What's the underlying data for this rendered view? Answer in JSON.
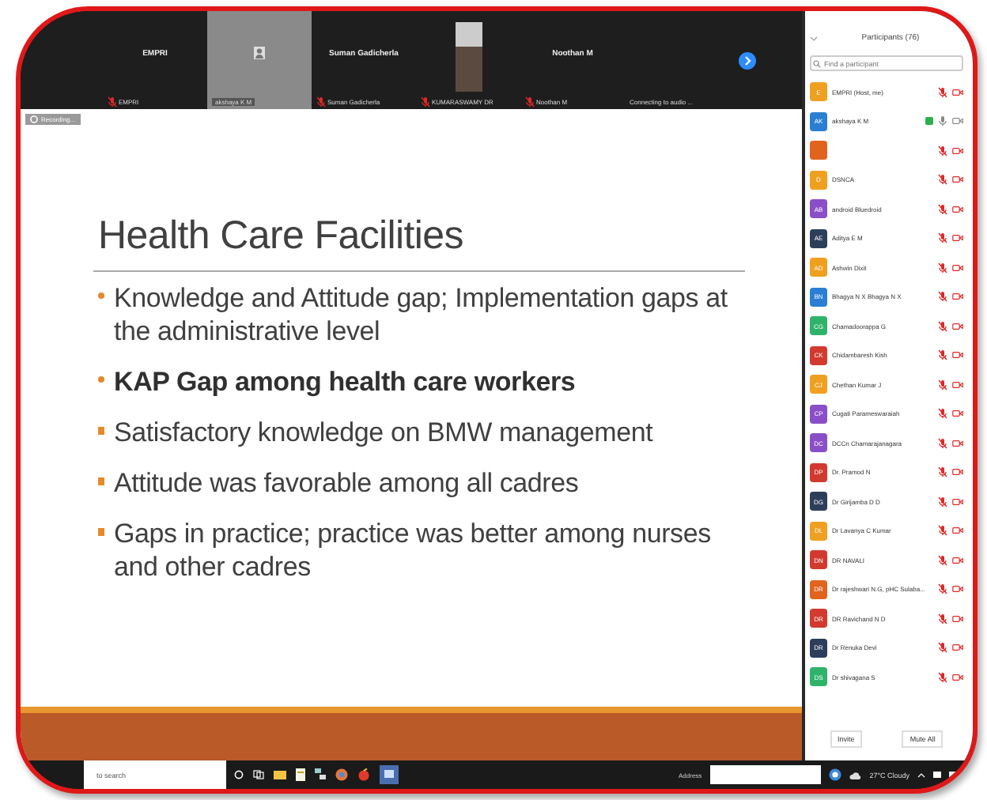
{
  "video_strip": {
    "tiles": [
      {
        "kind": "name",
        "name": "EMPRI",
        "label": "EMPRI",
        "muted": true
      },
      {
        "kind": "icon",
        "label": "akshaya K M",
        "muted": false
      },
      {
        "kind": "name",
        "name": "Suman Gadicherla",
        "label": "Suman Gadicherla",
        "muted": true
      },
      {
        "kind": "photo",
        "label": "KUMARASWAMY DR",
        "muted": true
      },
      {
        "kind": "name",
        "name": "Noothan M",
        "label": "Noothan M",
        "muted": true
      },
      {
        "kind": "blank",
        "label": "Connecting to audio ...",
        "muted": false
      }
    ]
  },
  "recording": {
    "label": "Recording..."
  },
  "slide": {
    "title": "Health Care Facilities",
    "bullets": [
      {
        "kind": "dot",
        "text": "Knowledge and Attitude gap; Implementation gaps at the administrative level",
        "bold": false
      },
      {
        "kind": "dot",
        "text": "KAP Gap among health care workers",
        "bold": true
      },
      {
        "kind": "square",
        "text": "Satisfactory knowledge on BMW management",
        "bold": false
      },
      {
        "kind": "square",
        "text": "Attitude was favorable among all cadres",
        "bold": false
      },
      {
        "kind": "square",
        "text": "Gaps in practice; practice was better among nurses and other cadres",
        "bold": false
      }
    ]
  },
  "participants": {
    "title": "Participants (76)",
    "search": {
      "placeholder": "Find a participant"
    },
    "items": [
      {
        "initials": "E",
        "name": "EMPRI (Host, me)",
        "color": "#f0a020",
        "muted": true,
        "speaking": false
      },
      {
        "initials": "AK",
        "name": "akshaya K M",
        "color": "#2a7fd4",
        "muted": false,
        "speaking": true
      },
      {
        "color": "#e0641e",
        "muted": true,
        "speaking": false
      },
      {
        "initials": "D",
        "name": "DSNCA",
        "color": "#f0a020",
        "muted": true,
        "speaking": false
      },
      {
        "initials": "AB",
        "name": "android Bluedroid",
        "color": "#8a4fc8",
        "muted": true,
        "speaking": false
      },
      {
        "initials": "AE",
        "name": "Aditya E M",
        "color": "#2c3e5a",
        "muted": true,
        "speaking": false
      },
      {
        "initials": "AD",
        "name": "Ashwin Dixit",
        "color": "#f0a020",
        "muted": true,
        "speaking": false
      },
      {
        "initials": "BN",
        "name": "Bhagya N X Bhagya N X",
        "color": "#2a7fd4",
        "muted": true,
        "speaking": false
      },
      {
        "initials": "CG",
        "name": "Chamadoorappa G",
        "color": "#2fb36a",
        "muted": true,
        "speaking": false
      },
      {
        "initials": "CK",
        "name": "Chidambaresh Kish",
        "color": "#d23a30",
        "muted": true,
        "speaking": false
      },
      {
        "initials": "CJ",
        "name": "Chethan Kumar J",
        "color": "#f0a020",
        "muted": true,
        "speaking": false
      },
      {
        "initials": "CP",
        "name": "Cugati Parameswaraiah",
        "color": "#8a4fc8",
        "muted": true,
        "speaking": false
      },
      {
        "initials": "DC",
        "name": "DCCn Chamarajanagara",
        "color": "#8a4fc8",
        "muted": true,
        "speaking": false
      },
      {
        "initials": "DP",
        "name": "Dr. Pramod N",
        "color": "#d23a30",
        "muted": true,
        "speaking": false
      },
      {
        "initials": "DG",
        "name": "Dr Girijamba D D",
        "color": "#2c3e5a",
        "muted": true,
        "speaking": false
      },
      {
        "initials": "DL",
        "name": "Dr Lavanya C Kumar",
        "color": "#f0a020",
        "muted": true,
        "speaking": false
      },
      {
        "initials": "DN",
        "name": "DR NAVALI",
        "color": "#d23a30",
        "muted": true,
        "speaking": false
      },
      {
        "initials": "DR",
        "name": "Dr rajeshwari N.G, pHC Sulaba...",
        "color": "#e0641e",
        "muted": true,
        "speaking": false
      },
      {
        "initials": "DR",
        "name": "DR Ravichand N D",
        "color": "#d23a30",
        "muted": true,
        "speaking": false
      },
      {
        "initials": "DR",
        "name": "Dr Renuka Devi",
        "color": "#2c3e5a",
        "muted": true,
        "speaking": false
      },
      {
        "initials": "DS",
        "name": "Dr shivagana S",
        "color": "#2fb36a",
        "muted": true,
        "speaking": false
      }
    ],
    "buttons": [
      "Invite",
      "Mute All"
    ]
  },
  "taskbar": {
    "search": "to search",
    "address_label": "Address",
    "weather": "27°C Cloudy"
  }
}
